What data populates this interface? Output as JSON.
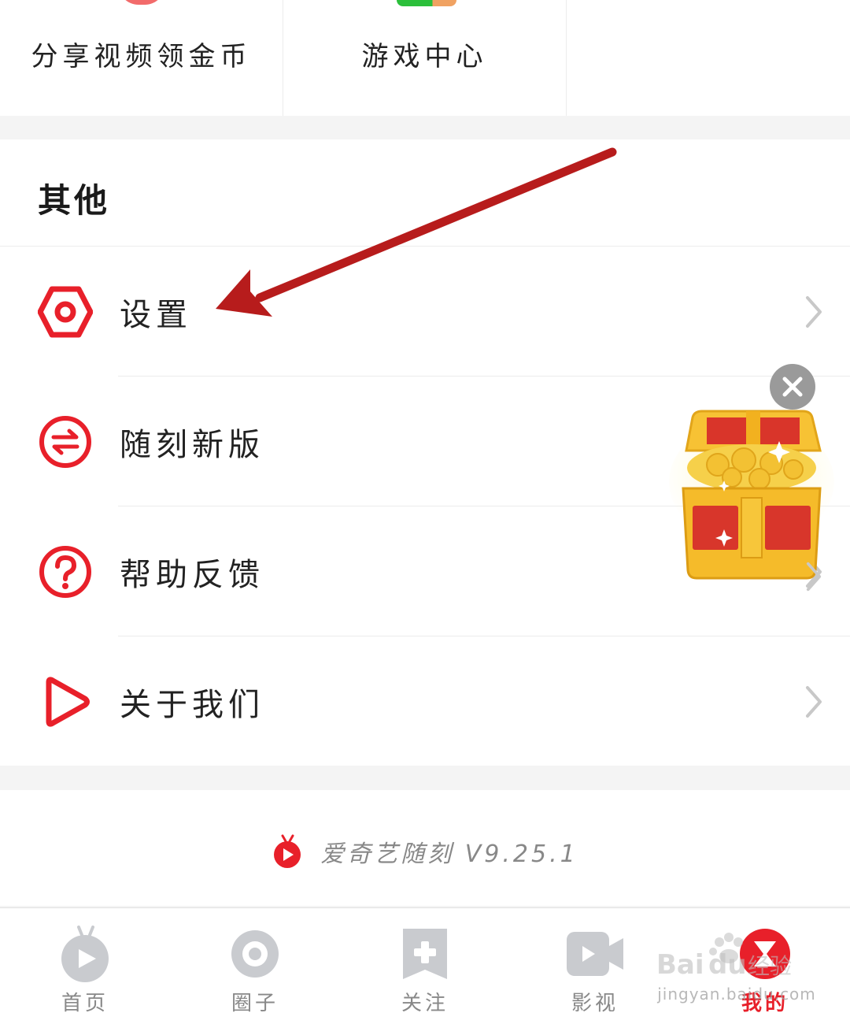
{
  "top_grid": {
    "items": [
      {
        "label": "分享视频领金币"
      },
      {
        "label": "游戏中心"
      },
      {
        "label": ""
      }
    ]
  },
  "other_section": {
    "title": "其他",
    "items": [
      {
        "label": "设置",
        "icon": "settings-hexagon-icon"
      },
      {
        "label": "随刻新版",
        "icon": "switch-arrows-icon"
      },
      {
        "label": "帮助反馈",
        "icon": "help-question-icon"
      },
      {
        "label": "关于我们",
        "icon": "play-triangle-icon"
      }
    ]
  },
  "footer": {
    "version_text": "爱奇艺随刻 V9.25.1"
  },
  "bottom_nav": {
    "items": [
      {
        "label": "首页",
        "icon": "tv-home-icon"
      },
      {
        "label": "圈子",
        "icon": "circle-ring-icon"
      },
      {
        "label": "关注",
        "icon": "bookmark-plus-icon"
      },
      {
        "label": "影视",
        "icon": "video-camera-icon"
      },
      {
        "label": "我的",
        "icon": "profile-hourglass-icon"
      }
    ],
    "active_index": 4
  },
  "watermark": {
    "brand": "Baidu经验",
    "url": "jingyan.baidu.com"
  },
  "colors": {
    "accent_red": "#e8202a",
    "annotation_arrow": "#b71c1c",
    "nav_gray": "#c9cbcf",
    "text_gray": "#888888"
  }
}
